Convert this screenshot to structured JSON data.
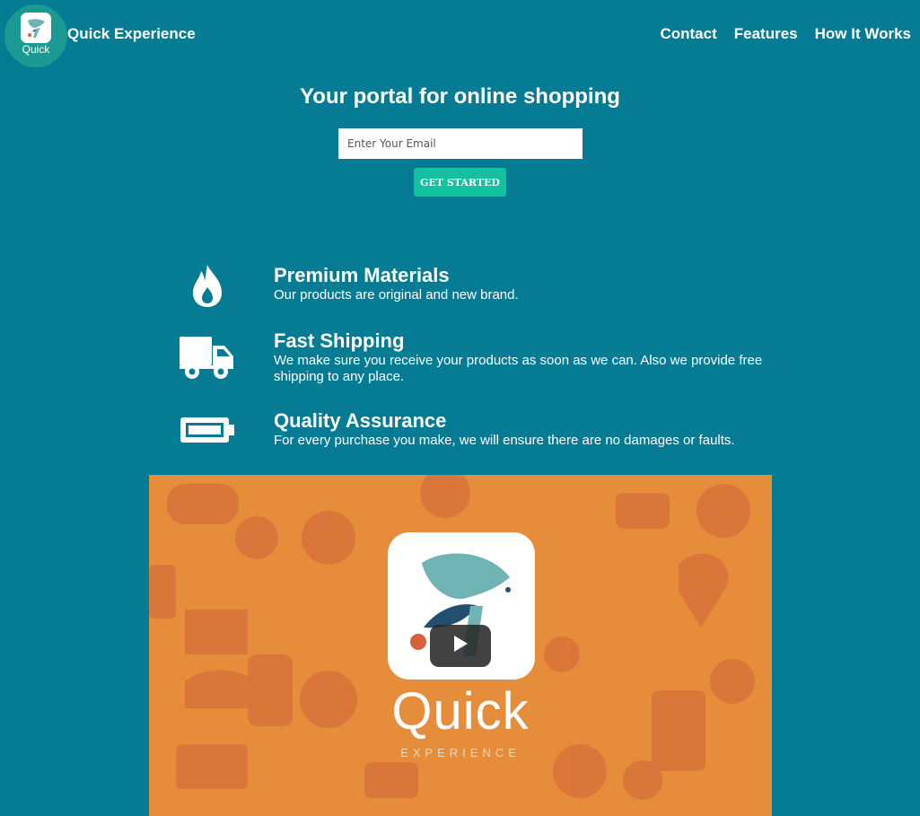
{
  "header": {
    "logo_text": "Quick",
    "brand": "Quick Experience",
    "nav": [
      "Contact",
      "Features",
      "How It Works"
    ]
  },
  "hero": {
    "heading": "Your portal for online shopping",
    "email_placeholder": "Enter Your Email",
    "cta_label": "GET STARTED"
  },
  "features": [
    {
      "icon": "fire-icon",
      "title": "Premium Materials",
      "description": "Our products are original and new brand."
    },
    {
      "icon": "truck-icon",
      "title": "Fast Shipping",
      "description": "We make sure you receive your products as soon as we can. Also we provide free shipping to any place."
    },
    {
      "icon": "battery-icon",
      "title": "Quality Assurance",
      "description": "For every purchase you make, we will ensure there are no damages or faults."
    }
  ],
  "video": {
    "logo_word": "Quick",
    "logo_sub": "EXPERIENCE",
    "play_icon": "play-icon"
  },
  "colors": {
    "background": "#057c93",
    "cta": "#13c1a0",
    "video_bg": "#e58d3a",
    "logo_teal": "#6fb3b4",
    "logo_navy": "#234f6e",
    "logo_orange": "#d6613a"
  }
}
